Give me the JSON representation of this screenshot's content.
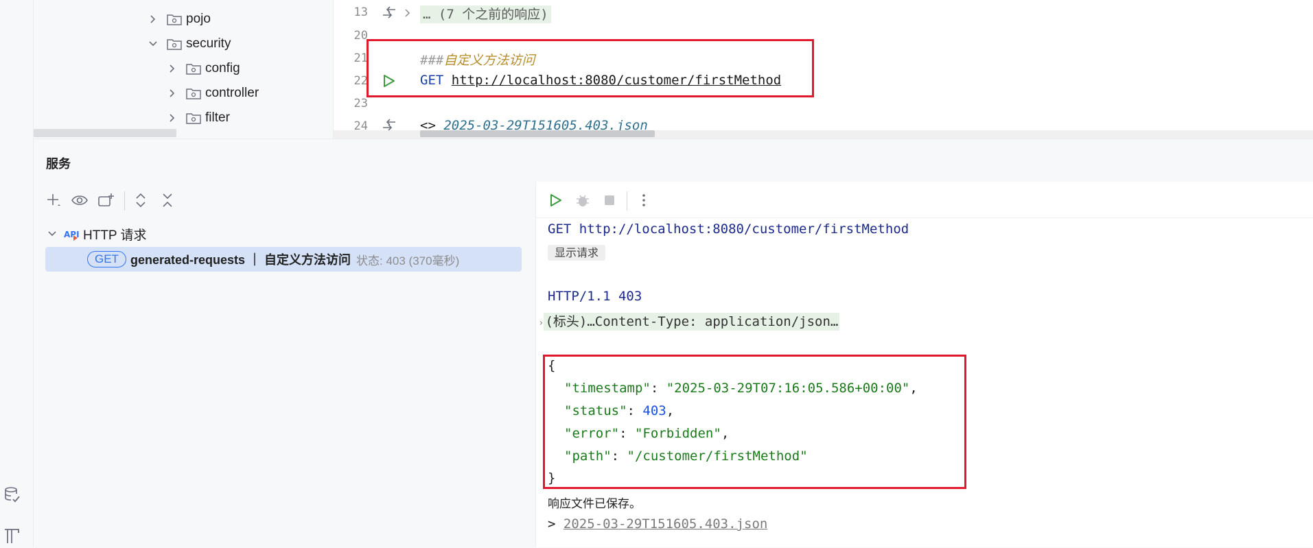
{
  "project_tree": {
    "items": [
      {
        "label": "pojo",
        "expanded": false
      },
      {
        "label": "security",
        "expanded": true
      },
      {
        "label": "config",
        "expanded": false
      },
      {
        "label": "controller",
        "expanded": false
      },
      {
        "label": "filter",
        "expanded": false
      }
    ]
  },
  "editor": {
    "line_numbers": [
      "13",
      "20",
      "21",
      "22",
      "23",
      "24"
    ],
    "collapsed_hint": "… (7 个之前的响应)",
    "comment_prefix": "###",
    "comment_text": "自定义方法访问",
    "method": "GET",
    "url": "http://localhost:8080/customer/firstMethod",
    "response_prefix": "<>",
    "response_file": "2025-03-29T151605.403.json"
  },
  "services": {
    "title": "服务",
    "toolbar_icons": [
      "add-icon",
      "eye-icon",
      "new-tab-icon",
      "expand-all-icon",
      "collapse-all-icon"
    ],
    "tree": {
      "group_label": "HTTP 请求",
      "request": {
        "method_badge": "GET",
        "name": "generated-requests ｜ 自定义方法访问",
        "status": "状态: 403 (370毫秒)"
      }
    }
  },
  "output": {
    "request_line": "GET http://localhost:8080/customer/firstMethod",
    "show_request_label": "显示请求",
    "status_line": "HTTP/1.1 403",
    "headers_collapsed": "(标头)…Content-Type: application/json…",
    "json": {
      "open": "{",
      "close": "}",
      "fields": [
        {
          "key": "\"timestamp\"",
          "value": "\"2025-03-29T07:16:05.586+00:00\"",
          "type": "string",
          "comma": ","
        },
        {
          "key": "\"status\"",
          "value": "403",
          "type": "number",
          "comma": ","
        },
        {
          "key": "\"error\"",
          "value": "\"Forbidden\"",
          "type": "string",
          "comma": ","
        },
        {
          "key": "\"path\"",
          "value": "\"/customer/firstMethod\"",
          "type": "string",
          "comma": ""
        }
      ]
    },
    "saved_message": "响应文件已保存。",
    "saved_prefix": ">",
    "saved_file": "2025-03-29T151605.403.json"
  },
  "colors": {
    "highlight_box": "#e0192d",
    "selection": "#d5e1f7",
    "run_green": "#3d9a3d",
    "accent_blue": "#3574f0"
  }
}
